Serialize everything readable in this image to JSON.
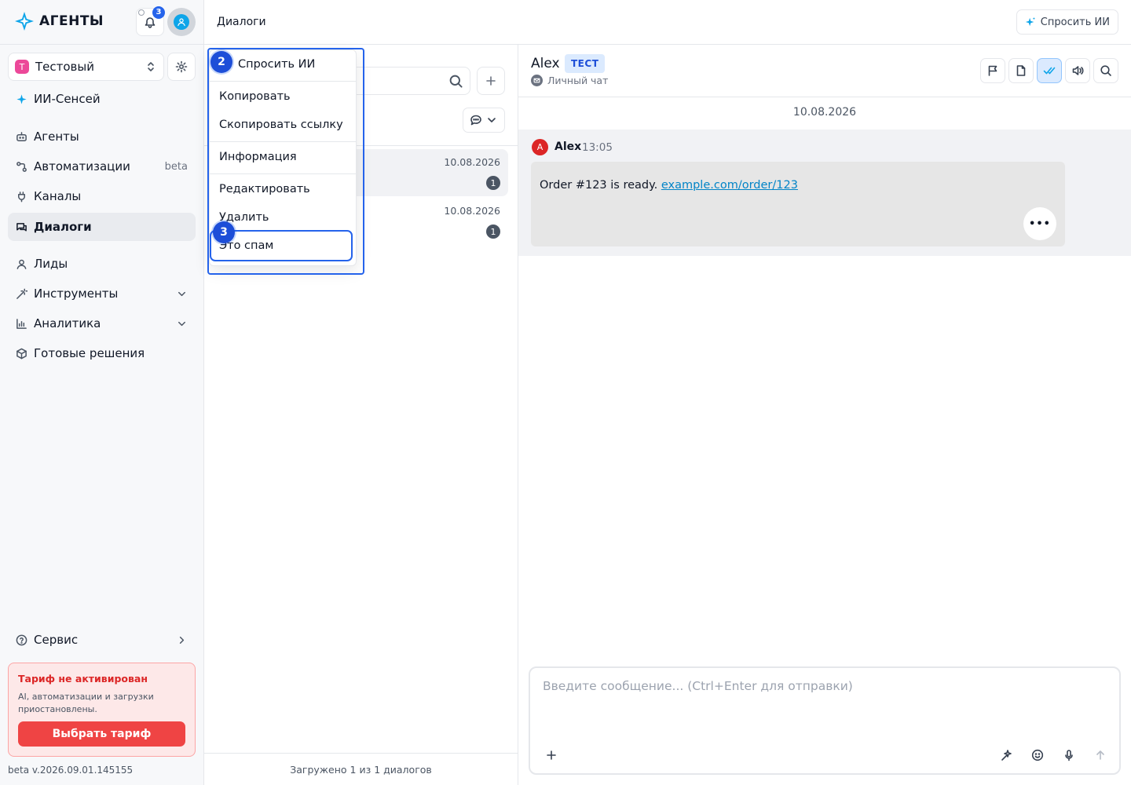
{
  "app": {
    "logo_text": "АГЕНТЫ",
    "notifications_count": "3"
  },
  "workspace": {
    "avatar_letter": "Т",
    "name": "Тестовый"
  },
  "sidebar": {
    "items": [
      {
        "label": "ИИ-Сенсей",
        "icon": "sparkle-icon"
      },
      {
        "label": "Агенты",
        "icon": "bot-icon"
      },
      {
        "label": "Автоматизации",
        "icon": "workflow-icon",
        "badge": "beta"
      },
      {
        "label": "Каналы",
        "icon": "plug-icon"
      },
      {
        "label": "Диалоги",
        "icon": "chat-icon",
        "active": true
      },
      {
        "label": "Лиды",
        "icon": "user-icon"
      },
      {
        "label": "Инструменты",
        "icon": "wand-icon",
        "expandable": true
      },
      {
        "label": "Аналитика",
        "icon": "bar-chart-icon",
        "expandable": true
      },
      {
        "label": "Готовые решения",
        "icon": "package-icon"
      }
    ],
    "service_label": "Сервис"
  },
  "tariff": {
    "title": "Тариф не активирован",
    "description": "AI, автоматизации и загрузки приостановлены.",
    "button": "Выбрать тариф"
  },
  "version": "beta v.2026.09.01.145155",
  "header": {
    "breadcrumb": "Диалоги",
    "ask_ai": "Спросить ИИ"
  },
  "dialog_list": {
    "rows": [
      {
        "date": "10.08.2026",
        "unread": "1",
        "selected": true
      },
      {
        "date": "10.08.2026",
        "unread": "1",
        "selected": false
      }
    ],
    "footer": "Загружено 1 из 1 диалогов"
  },
  "context_menu": {
    "items": {
      "ask_ai": "Спросить ИИ",
      "copy": "Копировать",
      "copy_link": "Скопировать ссылку",
      "info": "Информация",
      "edit": "Редактировать",
      "delete": "Удалить",
      "spam": "Это спам"
    },
    "step_badges": [
      "2",
      "3"
    ]
  },
  "chat": {
    "name": "Alex",
    "tag": "ТЕСТ",
    "subtitle": "Личный чат",
    "date_separator": "10.08.2026",
    "message": {
      "avatar_letter": "A",
      "author": "Alex",
      "time": "13:05",
      "text": "Order #123 is ready.",
      "link": "example.com/order/123",
      "more": "•••"
    },
    "composer_placeholder": "Введите сообщение... (Ctrl+Enter для отправки)"
  },
  "colors": {
    "accent": "#2563eb",
    "danger": "#ef4444",
    "brand_logo": "#0ea5e9"
  }
}
